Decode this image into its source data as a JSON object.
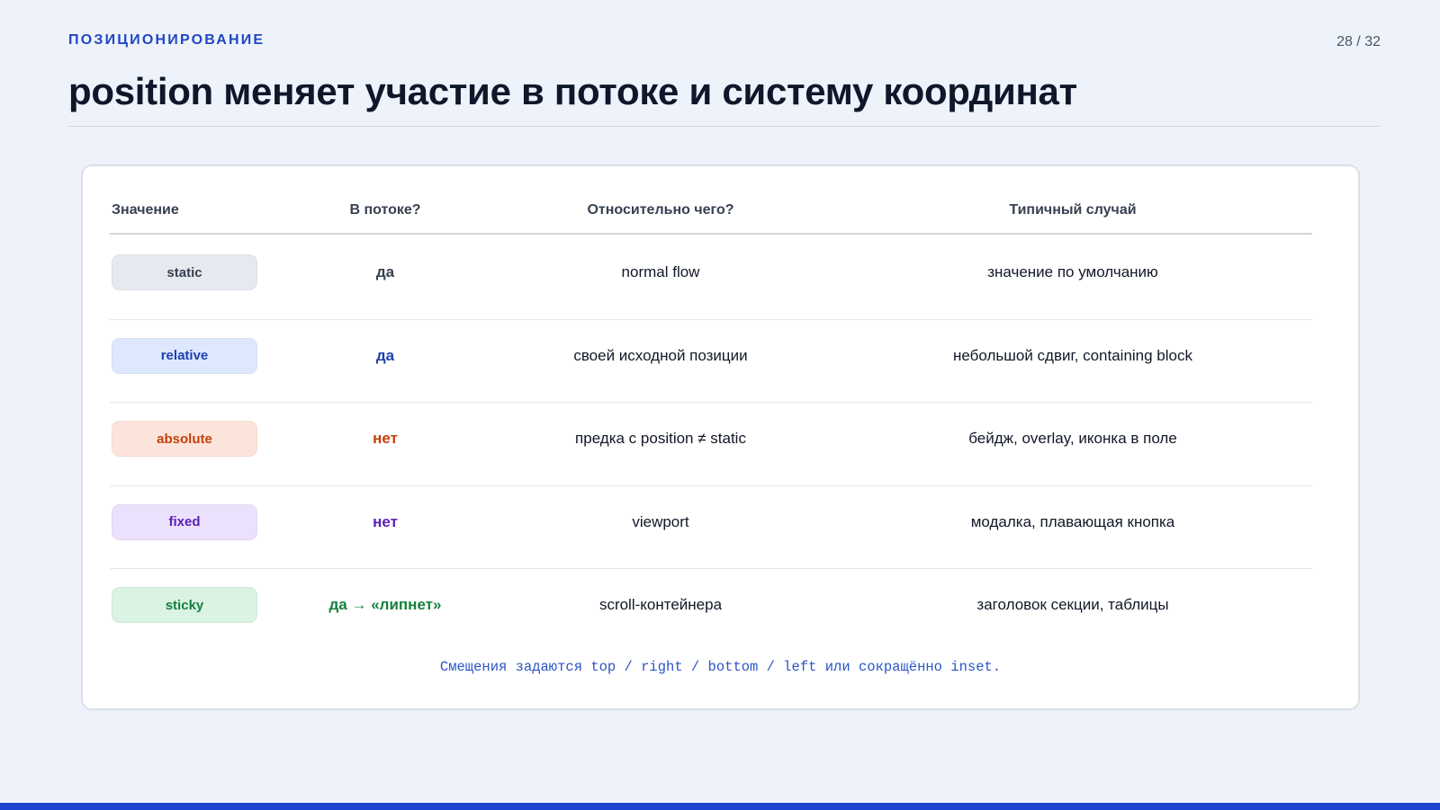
{
  "header": {
    "eyebrow": "ПОЗИЦИОНИРОВАНИЕ",
    "page_number": "28 / 32",
    "title": "position меняет участие в потоке и систему координат"
  },
  "table": {
    "columns": [
      "Значение",
      "В потоке?",
      "Относительно чего?",
      "Типичный случай"
    ],
    "rows": [
      {
        "value": "static",
        "in_flow": "да",
        "relative_to": "normal flow",
        "typical_case": "значение по умолчанию",
        "pill_bg": "#e6e9f0",
        "pill_color": "#374151",
        "flow_color": "#374151"
      },
      {
        "value": "relative",
        "in_flow": "да",
        "relative_to": "своей исходной позиции",
        "typical_case": "небольшой сдвиг, containing block",
        "pill_bg": "#dde8fd",
        "pill_color": "#1e40af",
        "flow_color": "#1e40af"
      },
      {
        "value": "absolute",
        "in_flow": "нет",
        "relative_to": "предка с position ≠ static",
        "typical_case": "бейдж, overlay, иконка в поле",
        "pill_bg": "#fde4da",
        "pill_color": "#c2410c",
        "flow_color": "#c2410c"
      },
      {
        "value": "fixed",
        "in_flow": "нет",
        "relative_to": "viewport",
        "typical_case": "модалка, плавающая кнопка",
        "pill_bg": "#ebe1fd",
        "pill_color": "#5b21b6",
        "flow_color": "#5b21b6"
      },
      {
        "value": "sticky",
        "in_flow": "да → «липнет»",
        "relative_to": "scroll-контейнера",
        "typical_case": "заголовок секции, таблицы",
        "pill_bg": "#daf3e3",
        "pill_color": "#15803d",
        "flow_color": "#15803d"
      }
    ]
  },
  "footnote": "Смещения задаются top / right / bottom / left или сокращённо inset.",
  "colors": {
    "accent": "#1f47c4",
    "background": "#eef2fa",
    "bottom_bar": "#1d44cf"
  }
}
